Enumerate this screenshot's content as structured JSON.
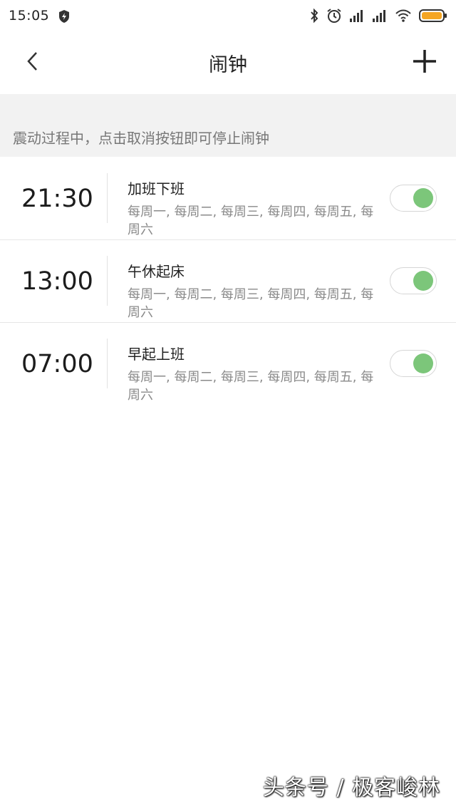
{
  "status_bar": {
    "time": "15:05"
  },
  "header": {
    "title": "闹钟"
  },
  "hint": {
    "text": "震动过程中，点击取消按钮即可停止闹钟"
  },
  "alarms": [
    {
      "time": "21:30",
      "name": "加班下班",
      "repeat": "每周一, 每周二, 每周三, 每周四, 每周五, 每周六",
      "enabled": true
    },
    {
      "time": "13:00",
      "name": "午休起床",
      "repeat": "每周一, 每周二, 每周三, 每周四, 每周五, 每周六",
      "enabled": true
    },
    {
      "time": "07:00",
      "name": "早起上班",
      "repeat": "每周一, 每周二, 每周三, 每周四, 每周五, 每周六",
      "enabled": true
    }
  ],
  "watermark": {
    "text": "头条号 / 极客峻林"
  },
  "colors": {
    "toggle_on": "#7cc67a",
    "battery": "#f5a623",
    "hint_background": "#f2f2f2"
  },
  "icons": {
    "shield": "shield-icon",
    "bluetooth": "bluetooth-icon",
    "alarm": "alarm-clock-icon",
    "signal": "signal-icon",
    "wifi": "wifi-icon",
    "battery": "battery-icon",
    "back": "chevron-left-icon",
    "add": "plus-icon"
  }
}
